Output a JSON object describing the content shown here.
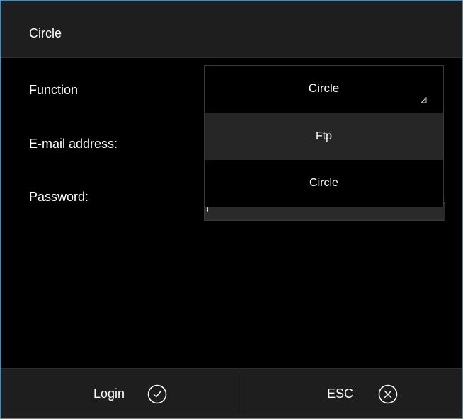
{
  "dialog": {
    "title": "Circle"
  },
  "form": {
    "function_label": "Function",
    "email_label": "E-mail address:",
    "password_label": "Password:"
  },
  "dropdown": {
    "selected": "Circle",
    "options": [
      {
        "label": "Ftp",
        "highlighted": true
      },
      {
        "label": "Circle",
        "highlighted": false
      }
    ],
    "caret_icon": "dropdown-caret-icon"
  },
  "footer": {
    "login_label": "Login",
    "login_icon": "check-circle-icon",
    "esc_label": "ESC",
    "esc_icon": "close-circle-icon"
  },
  "colors": {
    "window_border": "#3a8fc4",
    "bar_background": "#1e1e1e",
    "highlight_option": "#262626",
    "text": "#ffffff"
  }
}
